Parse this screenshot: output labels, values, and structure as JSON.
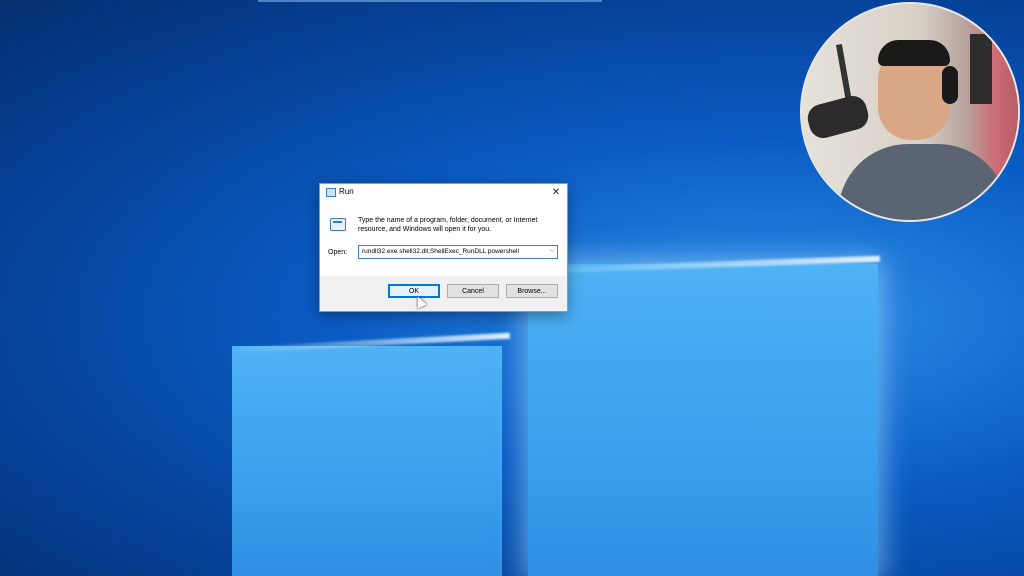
{
  "dialog": {
    "title": "Run",
    "close_symbol": "✕",
    "description": "Type the name of a program, folder, document, or Internet resource, and Windows will open it for you.",
    "open_label": "Open:",
    "open_value": "rundll32.exe shell32.dll,ShellExec_RunDLL powershell",
    "dropdown_symbol": "⌵",
    "buttons": {
      "ok": "OK",
      "cancel": "Cancel",
      "browse": "Browse..."
    }
  },
  "icons": [
    "run-app-icon",
    "run-dialog-icon",
    "close-icon",
    "chevron-down-icon",
    "mouse-cursor-icon"
  ],
  "colors": {
    "accent": "#0078d7",
    "desktop": "#0a5cc4"
  }
}
